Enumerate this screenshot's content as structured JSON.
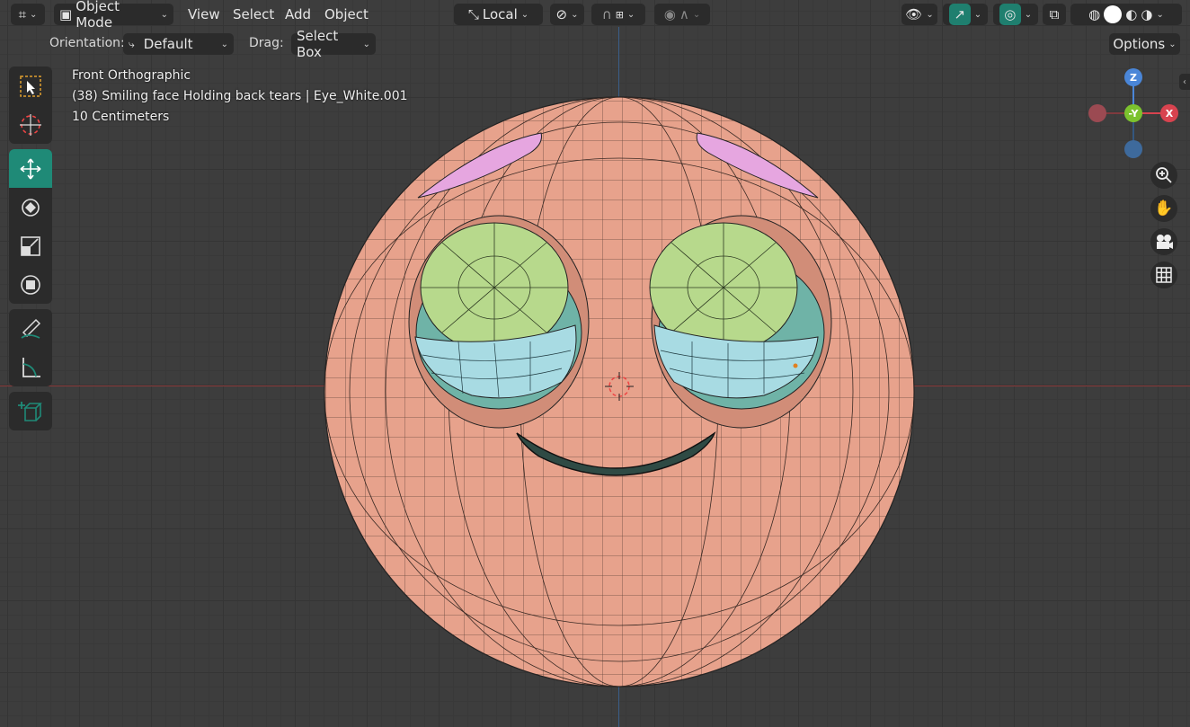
{
  "header": {
    "mode": "Object Mode",
    "menus": [
      "View",
      "Select",
      "Add",
      "Object"
    ],
    "transform_orientation": "Local"
  },
  "subheader": {
    "orientation_label": "Orientation:",
    "orientation_value": "Default",
    "drag_label": "Drag:",
    "drag_value": "Select Box",
    "options_label": "Options"
  },
  "viewport_info": {
    "view_name": "Front Orthographic",
    "object_info": "(38) Smiling face Holding back tears | Eye_White.001",
    "scale": "10 Centimeters"
  },
  "gizmo": {
    "z_label": "Z",
    "y_label": "-Y",
    "x_label": "X"
  },
  "colors": {
    "accent": "#1f8a77",
    "skin": "#e7a28c",
    "brow": "#e6a6e0",
    "iris": "#b7d98c",
    "tear": "#a8dbe3",
    "axis_x": "#d8434f",
    "axis_y": "#7cc22e",
    "axis_z": "#4a86d8"
  },
  "icons": {
    "editor_type": "grid-axis-icon",
    "tools": [
      "select-box-icon",
      "cursor-icon",
      "move-icon",
      "rotate-icon",
      "scale-icon",
      "transform-icon",
      "annotate-icon",
      "measure-icon",
      "add-cube-icon"
    ],
    "nav": [
      "zoom-icon",
      "hand-pan-icon",
      "camera-icon",
      "grid-ortho-icon"
    ]
  }
}
